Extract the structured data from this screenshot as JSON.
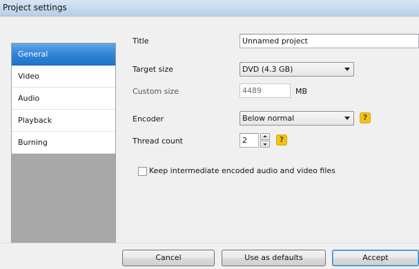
{
  "window": {
    "title": "Project settings"
  },
  "sidebar": {
    "items": [
      {
        "label": "General",
        "active": true
      },
      {
        "label": "Video"
      },
      {
        "label": "Audio"
      },
      {
        "label": "Playback"
      },
      {
        "label": "Burning"
      }
    ]
  },
  "form": {
    "title": {
      "label": "Title",
      "value": "Unnamed project"
    },
    "target_size": {
      "label": "Target size",
      "value": "DVD (4.3 GB)"
    },
    "custom_size": {
      "label": "Custom size",
      "value": "4489",
      "unit": "MB"
    },
    "encoder": {
      "label": "Encoder",
      "value": "Below normal",
      "help": "?"
    },
    "thread_count": {
      "label": "Thread count",
      "value": "2",
      "help": "?"
    },
    "keep_files": {
      "label": "Keep intermediate encoded audio and video files",
      "checked": false
    }
  },
  "buttons": {
    "cancel": "Cancel",
    "use_defaults": "Use as defaults",
    "accept": "Accept"
  }
}
